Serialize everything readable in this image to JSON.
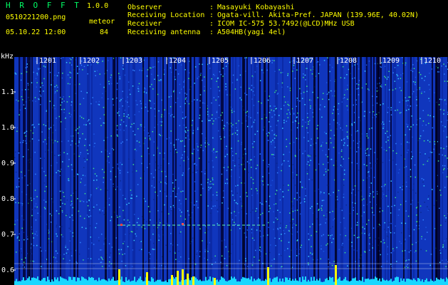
{
  "app": {
    "title": "H R O F F T",
    "version": "1.0.0"
  },
  "file": {
    "name": "0510221200.png",
    "timestamp": "05.10.22 12:00"
  },
  "meteor": {
    "label": "meteor",
    "count": "84"
  },
  "info": [
    {
      "key": "Observer",
      "value": "Masayuki Kobayashi"
    },
    {
      "key": "Receiving Location",
      "value": "Ogata-vill. Akita-Pref. JAPAN (139.96E, 40.02N)"
    },
    {
      "key": "Receiver",
      "value": "ICOM IC-575 53.7492(@LCD)MHz USB"
    },
    {
      "key": "Receiving antenna",
      "value": "A504HB(yagi 4el)"
    }
  ],
  "separator": ":",
  "axes": {
    "unit": "kHz",
    "y_ticks": [
      "1.1",
      "1.0",
      "0.9",
      "0.8",
      "0.7",
      "0.6"
    ],
    "x_ticks": [
      "1201",
      "1202",
      "1203",
      "1204",
      "1205",
      "1206",
      "1207",
      "1208",
      "1209",
      "1210"
    ]
  },
  "colors": {
    "label": "#ffff00",
    "title": "#00ff66",
    "background": "#000000",
    "noise_base": "#0a1f8f",
    "grid": "#ffffff"
  }
}
